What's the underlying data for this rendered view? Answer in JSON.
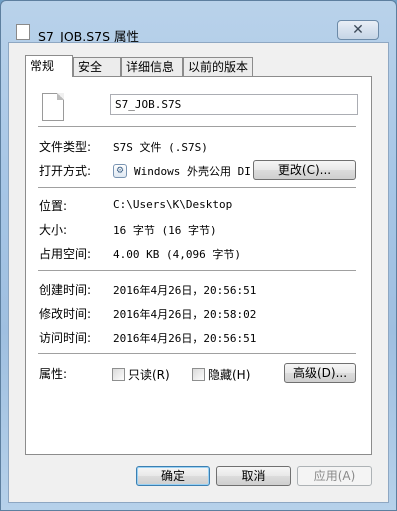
{
  "window": {
    "title": "S7_JOB.S7S 属性",
    "close_glyph": "✕"
  },
  "tabs": [
    {
      "label": "常规",
      "active": true
    },
    {
      "label": "安全",
      "active": false
    },
    {
      "label": "详细信息",
      "active": false
    },
    {
      "label": "以前的版本",
      "active": false
    }
  ],
  "general": {
    "file_name": "S7_JOB.S7S",
    "file_type_label": "文件类型:",
    "file_type_value": "S7S 文件 (.S7S)",
    "opens_with_label": "打开方式:",
    "opens_with_value": "Windows 外壳公用 DI",
    "change_button": "更改(C)...",
    "location_label": "位置:",
    "location_value": "C:\\Users\\K\\Desktop",
    "size_label": "大小:",
    "size_value": "16 字节 (16 字节)",
    "size_on_disk_label": "占用空间:",
    "size_on_disk_value": "4.00 KB (4,096 字节)",
    "created_label": "创建时间:",
    "created_value": "2016年4月26日，20:56:51",
    "modified_label": "修改时间:",
    "modified_value": "2016年4月26日，20:58:02",
    "accessed_label": "访问时间:",
    "accessed_value": "2016年4月26日，20:56:51",
    "attributes_label": "属性:",
    "readonly_label": "只读(R)",
    "readonly_checked": false,
    "hidden_label": "隐藏(H)",
    "hidden_checked": false,
    "advanced_button": "高级(D)..."
  },
  "footer": {
    "ok": "确定",
    "cancel": "取消",
    "apply": "应用(A)"
  }
}
